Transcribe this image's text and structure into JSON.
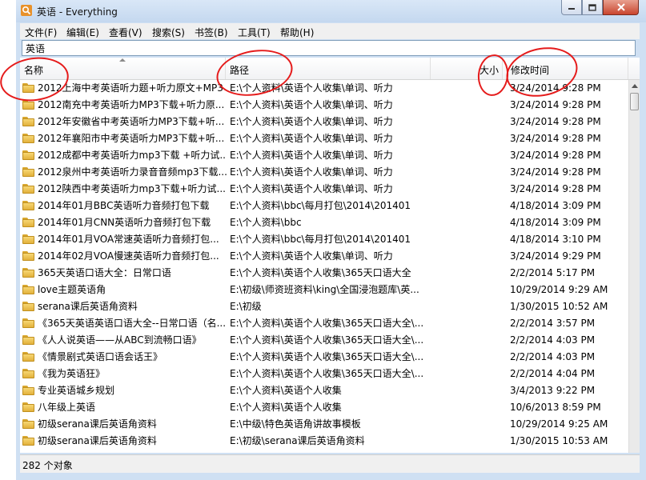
{
  "window": {
    "title": "英语 - Everything"
  },
  "menu": [
    "文件(F)",
    "编辑(E)",
    "查看(V)",
    "搜索(S)",
    "书签(B)",
    "工具(T)",
    "帮助(H)"
  ],
  "search": {
    "value": "英语"
  },
  "columns": {
    "name": "名称",
    "path": "路径",
    "size": "大小",
    "modified": "修改时间"
  },
  "rows": [
    {
      "name": "2012上海中考英语听力题+听力原文+MP3",
      "path": "E:\\个人资料\\英语个人收集\\单词、听力",
      "modified": "3/24/2014 9:28 PM"
    },
    {
      "name": "2012南充中考英语听力MP3下载+听力原...",
      "path": "E:\\个人资料\\英语个人收集\\单词、听力",
      "modified": "3/24/2014 9:28 PM"
    },
    {
      "name": "2012年安徽省中考英语听力MP3下载+听...",
      "path": "E:\\个人资料\\英语个人收集\\单词、听力",
      "modified": "3/24/2014 9:28 PM"
    },
    {
      "name": "2012年襄阳市中考英语听力MP3下载+听...",
      "path": "E:\\个人资料\\英语个人收集\\单词、听力",
      "modified": "3/24/2014 9:28 PM"
    },
    {
      "name": "2012成都中考英语听力mp3下载 +听力试...",
      "path": "E:\\个人资料\\英语个人收集\\单词、听力",
      "modified": "3/24/2014 9:28 PM"
    },
    {
      "name": "2012泉州中考英语听力录音音频mp3下载...",
      "path": "E:\\个人资料\\英语个人收集\\单词、听力",
      "modified": "3/24/2014 9:28 PM"
    },
    {
      "name": "2012陕西中考英语听力mp3下载+听力试...",
      "path": "E:\\个人资料\\英语个人收集\\单词、听力",
      "modified": "3/24/2014 9:28 PM"
    },
    {
      "name": "2014年01月BBC英语听力音频打包下载",
      "path": "E:\\个人资料\\bbc\\每月打包\\2014\\201401",
      "modified": "4/18/2014 3:09 PM"
    },
    {
      "name": "2014年01月CNN英语听力音频打包下载",
      "path": "E:\\个人资料\\bbc",
      "modified": "4/18/2014 3:09 PM"
    },
    {
      "name": "2014年01月VOA常速英语听力音频打包...",
      "path": "E:\\个人资料\\bbc\\每月打包\\2014\\201401",
      "modified": "4/18/2014 3:10 PM"
    },
    {
      "name": "2014年02月VOA慢速英语听力音频打包...",
      "path": "E:\\个人资料\\英语个人收集\\单词、听力",
      "modified": "3/24/2014 9:29 PM"
    },
    {
      "name": "365天英语口语大全：日常口语",
      "path": "E:\\个人资料\\英语个人收集\\365天口语大全",
      "modified": "2/2/2014 5:17 PM"
    },
    {
      "name": "love主题英语角",
      "path": "E:\\初级\\师资班资料\\king\\全国浸泡题库\\英...",
      "modified": "10/29/2014 9:29 AM"
    },
    {
      "name": "serana课后英语角资料",
      "path": "E:\\初级",
      "modified": "1/30/2015 10:52 AM"
    },
    {
      "name": "《365天英语英语口语大全--日常口语（名...",
      "path": "E:\\个人资料\\英语个人收集\\365天口语大全\\...",
      "modified": "2/2/2014 3:57 PM"
    },
    {
      "name": "《人人说英语——从ABC到流畅口语》",
      "path": "E:\\个人资料\\英语个人收集\\365天口语大全\\...",
      "modified": "2/2/2014 4:03 PM"
    },
    {
      "name": "《情景剧式英语口语会话王》",
      "path": "E:\\个人资料\\英语个人收集\\365天口语大全\\...",
      "modified": "2/2/2014 4:03 PM"
    },
    {
      "name": "《我为英语狂》",
      "path": "E:\\个人资料\\英语个人收集\\365天口语大全\\...",
      "modified": "2/2/2014 4:04 PM"
    },
    {
      "name": "专业英语城乡规划",
      "path": "E:\\个人资料\\英语个人收集",
      "modified": "3/4/2013 9:22 PM"
    },
    {
      "name": "八年级上英语",
      "path": "E:\\个人资料\\英语个人收集",
      "modified": "10/6/2013 8:59 PM"
    },
    {
      "name": "初级serana课后英语角资料",
      "path": "E:\\中级\\特色英语角讲故事模板",
      "modified": "10/29/2014 9:25 AM"
    },
    {
      "name": "初级serana课后英语角资料",
      "path": "E:\\初级\\serana课后英语角资料",
      "modified": "1/30/2015 10:53 AM"
    },
    {
      "name": "",
      "path": "",
      "modified": ""
    }
  ],
  "status": {
    "text": "282 个对象"
  },
  "annotation_color": "#e51b1b"
}
